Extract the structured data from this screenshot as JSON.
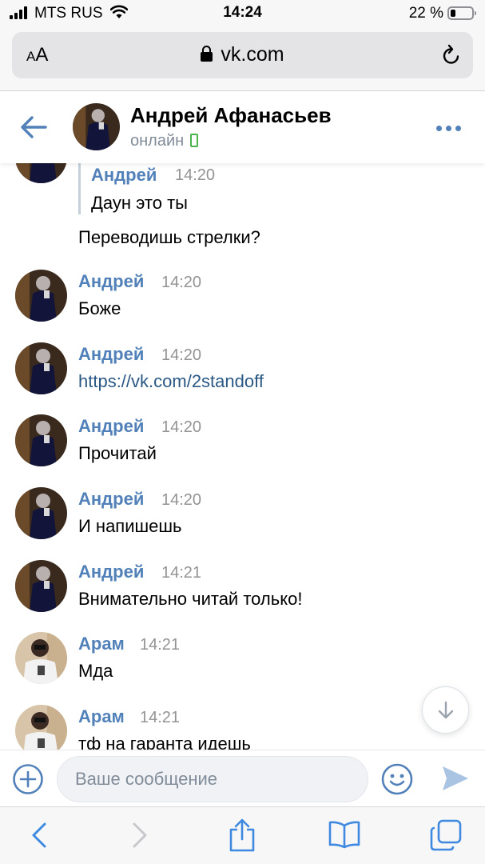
{
  "status_bar": {
    "carrier": "MTS RUS",
    "time": "14:24",
    "battery_percent_text": "22 %",
    "battery_level": 0.22
  },
  "browser": {
    "text_size_label_small": "A",
    "text_size_label_large": "A",
    "url": "vk.com"
  },
  "chat": {
    "name": "Андрей Афанасьев",
    "status": "онлайн"
  },
  "messages": {
    "quote": {
      "author": "Андрей",
      "time": "14:20",
      "text": "Даун это ты"
    },
    "continued_text": "Переводишь стрелки?",
    "items": [
      {
        "author": "Андрей",
        "time": "14:20",
        "text": "Боже"
      },
      {
        "author": "Андрей",
        "time": "14:20",
        "text": "https://vk.com/2standoff"
      },
      {
        "author": "Андрей",
        "time": "14:20",
        "text": "Прочитай"
      },
      {
        "author": "Андрей",
        "time": "14:20",
        "text": "И напишешь"
      },
      {
        "author": "Андрей",
        "time": "14:21",
        "text": "Внимательно читай только!"
      },
      {
        "author": "Арам",
        "time": "14:21",
        "text": "Мда"
      },
      {
        "author": "Арам",
        "time": "14:21",
        "text": "тф на гаранта идешь"
      }
    ]
  },
  "composer": {
    "placeholder": "Ваше сообщение"
  },
  "colors": {
    "vk_blue": "#5181b8",
    "link": "#2a5885",
    "online_green": "#4bb34b",
    "ios_blue": "#3f8ae0"
  }
}
